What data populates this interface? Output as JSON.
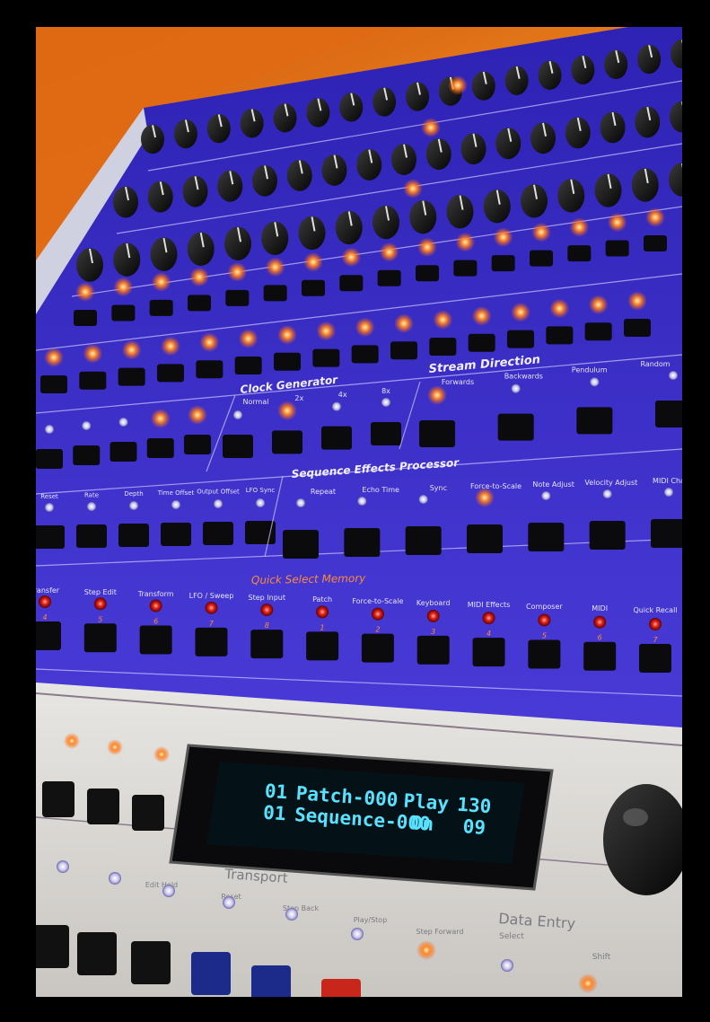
{
  "sections": {
    "clock_generator": "Clock Generator",
    "stream_direction": "Stream Direction",
    "sequence_effects": "Sequence Effects Processor",
    "quick_select": "Quick Select Memory",
    "transport": "Transport",
    "data_entry": "Data Entry"
  },
  "clock_labels": [
    "Normal",
    "2x",
    "4x",
    "8x"
  ],
  "stream_labels": [
    "Forwards",
    "Backwards",
    "Pendulum",
    "Random"
  ],
  "effect_labels": [
    "Repeat",
    "Echo Time",
    "Sync",
    "Force-to-Scale",
    "Note Adjust",
    "Velocity Adjust",
    "MIDI Cha"
  ],
  "lfo_labels": [
    "Reset",
    "Rate",
    "Depth",
    "Time Offset",
    "Output Offset",
    "LFO Sync"
  ],
  "quick_labels": [
    "Transfer",
    "Step Edit",
    "Transform",
    "LFO / Sweep",
    "Step Input",
    "Patch",
    "Force-to-Scale",
    "Keyboard",
    "MIDI Effects",
    "Composer",
    "MIDI",
    "Quick Recall"
  ],
  "quick_numbers": [
    "4",
    "5",
    "6",
    "7",
    "8",
    "1",
    "2",
    "3",
    "4",
    "5",
    "6",
    "7"
  ],
  "transport_labels": [
    "Edit Hold",
    "Reset",
    "Step Back",
    "Play/Stop",
    "Step Forward"
  ],
  "data_entry_labels": [
    "Select",
    "Shift"
  ],
  "lcd": {
    "line1": {
      "num": "01",
      "name": "Patch-000",
      "mode": "Play",
      "value": "130"
    },
    "line2": {
      "num": "01",
      "name": "Sequence-000",
      "mode": "On",
      "value": "09"
    }
  },
  "colors": {
    "panel_blue": "#3a2cc8",
    "panel_silver": "#d9d6d2",
    "led_on": "#ff7a1e",
    "lcd_text": "#57e3ff"
  }
}
